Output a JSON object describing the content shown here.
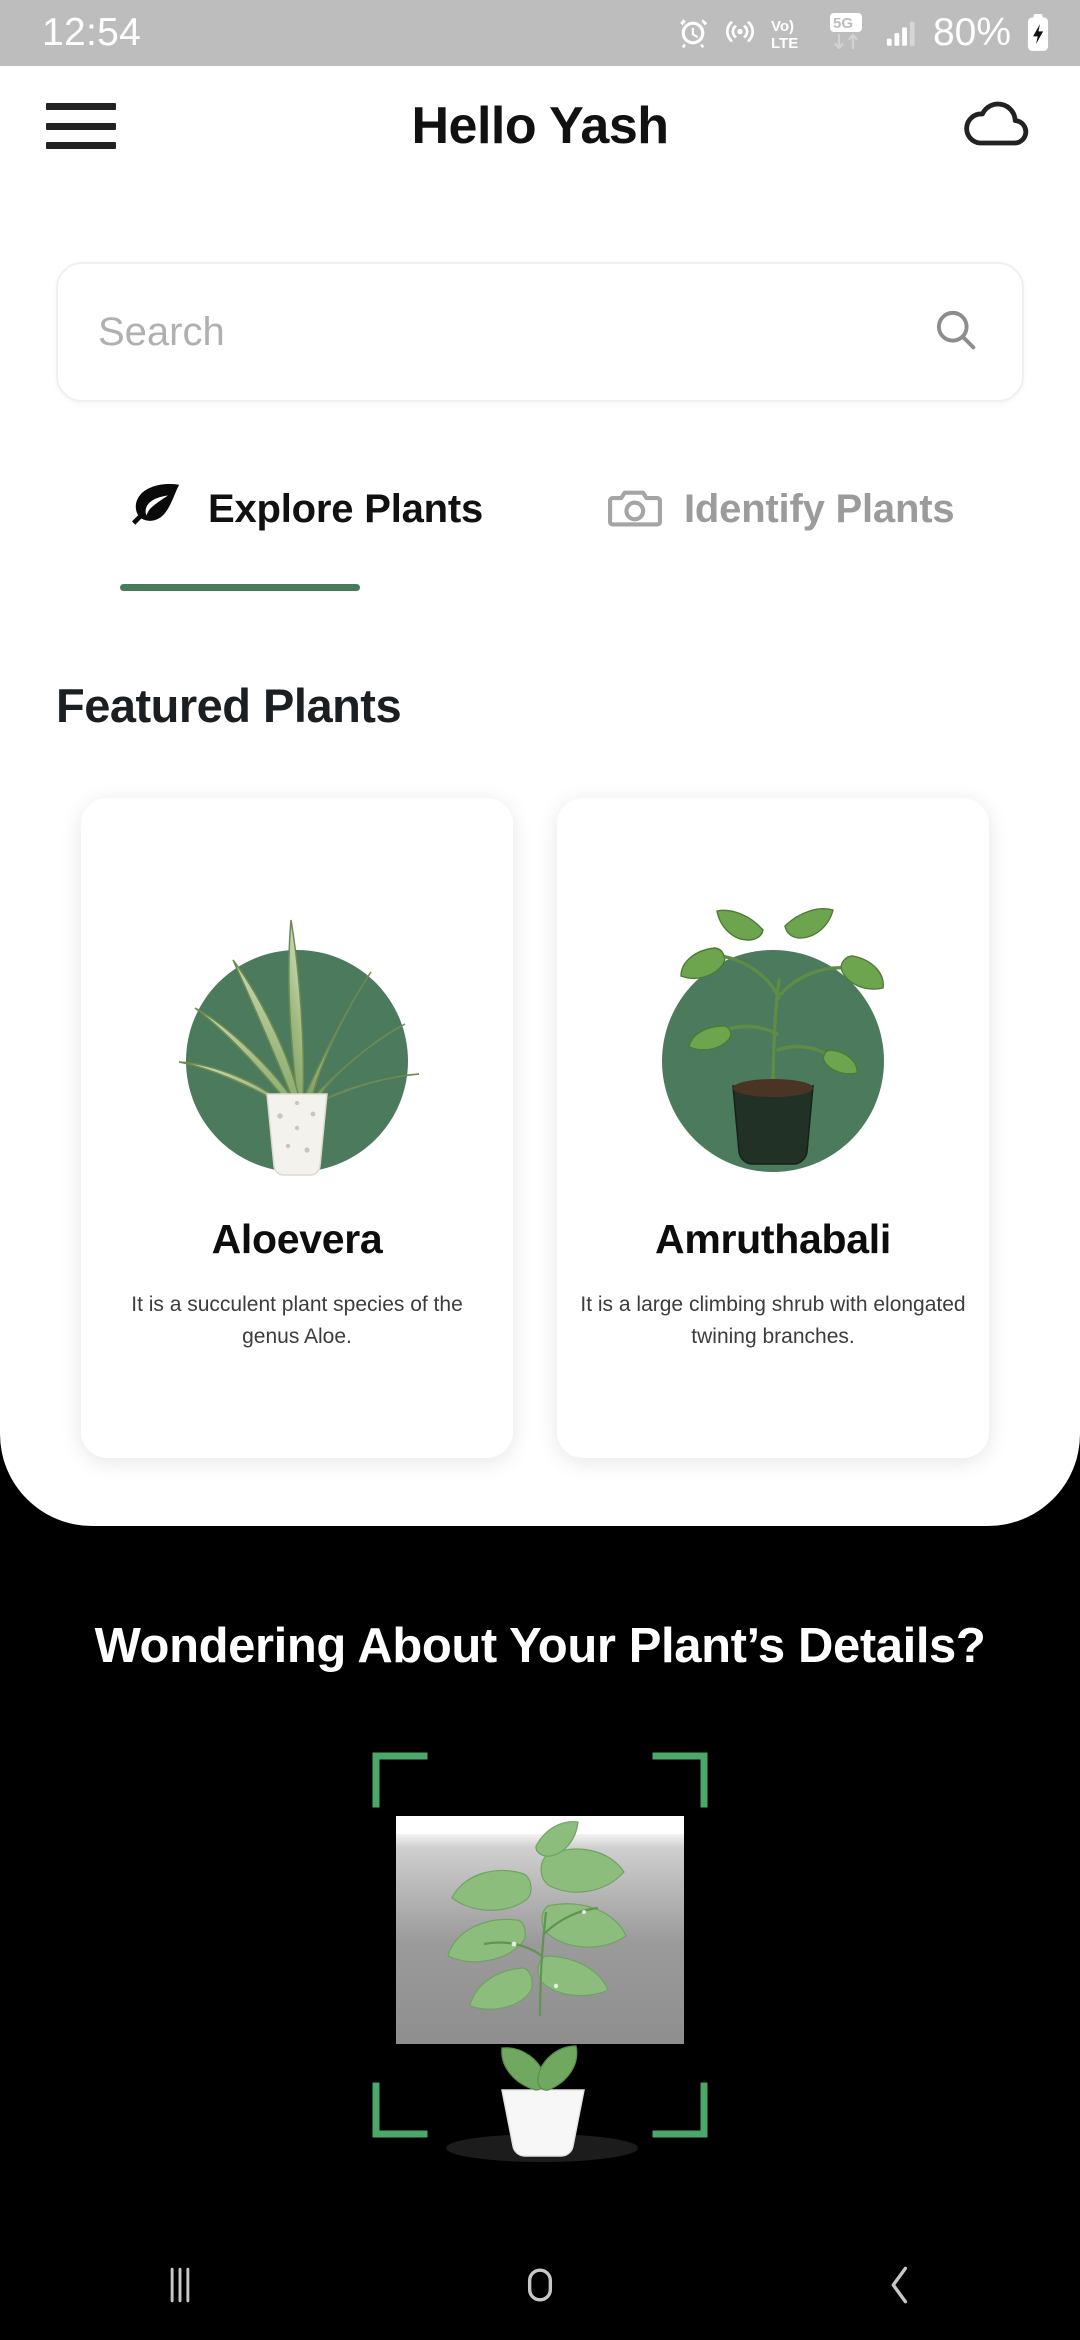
{
  "status_bar": {
    "time": "12:54",
    "battery_percent": "80%",
    "icons": [
      "alarm-icon",
      "hotspot-icon",
      "volte-lte-icon",
      "5g-data-icon",
      "signal-bars-icon",
      "battery-charging-icon"
    ]
  },
  "app_bar": {
    "menu_icon": "hamburger-menu-icon",
    "title": "Hello Yash",
    "cloud_icon": "cloud-icon"
  },
  "search": {
    "placeholder": "Search",
    "value": "",
    "icon": "search-icon"
  },
  "tabs": [
    {
      "label": "Explore Plants",
      "icon": "leaf-icon",
      "active": true
    },
    {
      "label": "Identify Plants",
      "icon": "camera-icon",
      "active": false
    }
  ],
  "featured": {
    "heading": "Featured Plants",
    "cards": [
      {
        "name": "Aloevera",
        "description": "It is a succulent plant species of the genus Aloe.",
        "art": "aloevera-plant-image"
      },
      {
        "name": "Amruthabali",
        "description": "It is a large climbing shrub with elongated twining branches.",
        "art": "amruthabali-plant-image"
      }
    ]
  },
  "identify_promo": {
    "heading": "Wondering About Your Plant’s Details?",
    "scan_image": "monstera-plant-scan-image",
    "frame_icon": "scan-frame-icon"
  },
  "nav_bar": {
    "recents_label": "|||",
    "home_label": "◯",
    "back_label": "‹"
  },
  "colors": {
    "accent_green": "#4a7a5c",
    "circle_green": "#4b7a5d",
    "status_bar_bg": "#bdbdbd",
    "dark_bg": "#000000",
    "sheet_bg": "#ffffff",
    "muted_text": "#9b9b9b"
  }
}
